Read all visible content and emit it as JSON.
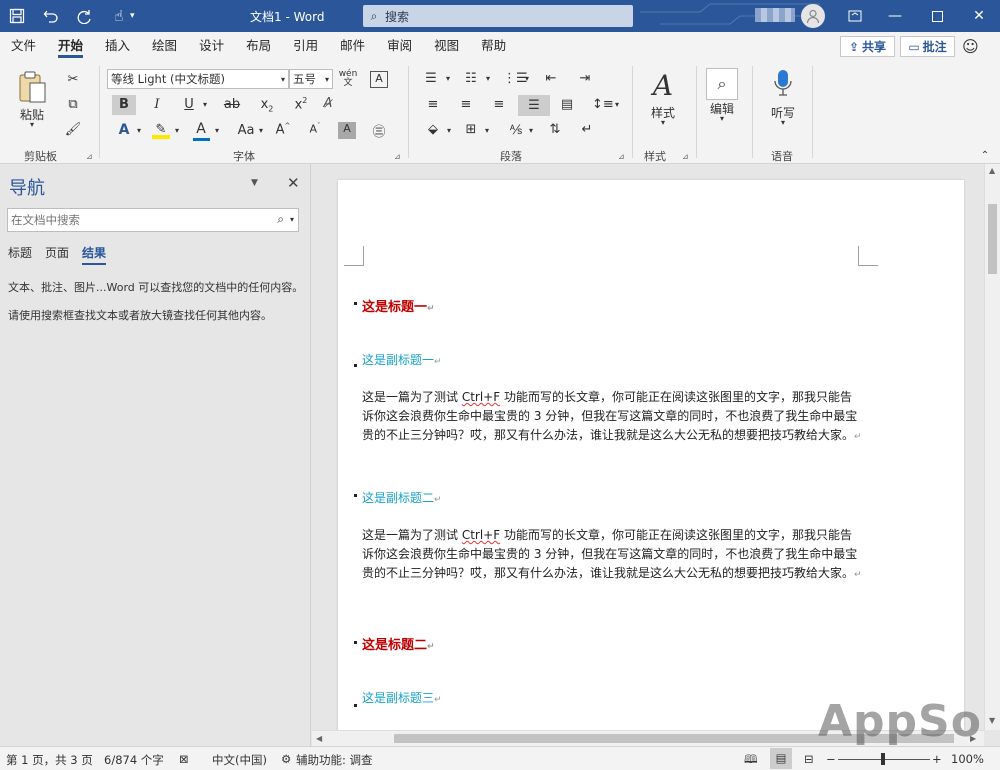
{
  "window": {
    "doc_title": "文档1  -  Word",
    "search_placeholder": "搜索"
  },
  "menu": {
    "tabs": [
      "文件",
      "开始",
      "插入",
      "绘图",
      "设计",
      "布局",
      "引用",
      "邮件",
      "审阅",
      "视图",
      "帮助"
    ],
    "active_tab": "开始",
    "share_label": "共享",
    "comment_label": "批注"
  },
  "ribbon": {
    "paste_label": "粘贴",
    "clipboard_group": "剪贴板",
    "font_name": "等线 Light (中文标题)",
    "font_size": "五号",
    "font_group": "字体",
    "font_color": "#0070c0",
    "highlight_color": "#ffe800",
    "paragraph_group": "段落",
    "styles_label": "样式",
    "styles_group": "样式",
    "editing_label": "编辑",
    "dictate_label": "听写",
    "voice_group": "语音"
  },
  "nav": {
    "title": "导航",
    "search_placeholder": "在文档中搜索",
    "tabs": [
      "标题",
      "页面",
      "结果"
    ],
    "active_tab": "结果",
    "msg1": "文本、批注、图片...Word 可以查找您的文档中的任何内容。",
    "msg2": "请使用搜索框查找文本或者放大镜查找任何其他内容。"
  },
  "document": {
    "heading1": "这是标题一",
    "subheading1": "这是副标题一",
    "para1_a": "这是一篇为了测试 ",
    "para1_key": "Ctrl+F",
    "para1_b": " 功能而写的长文章，你可能正在阅读这张图里的文字，那我只能告诉你这会浪费你生命中最宝贵的 3 分钟，但我在写这篇文章的同时，不也浪费了我生命中最宝贵的不止三分钟吗？哎，那又有什么办法，谁让我就是这么大公无私的想要把技巧教给大家。",
    "subheading2": "这是副标题二",
    "para2_a": "这是一篇为了测试 ",
    "para2_key": "Ctrl+F",
    "para2_b": " 功能而写的长文章，你可能正在阅读这张图里的文字，那我只能告诉你这会浪费你生命中最宝贵的 3 分钟，但我在写这篇文章的同时，不也浪费了我生命中最宝贵的不止三分钟吗？哎，那又有什么办法，谁让我就是这么大公无私的想要把技巧教给大家。",
    "heading2": "这是标题二",
    "subheading3": "这是副标题三",
    "para_mark": "↵"
  },
  "status": {
    "page": "第 1 页，共 3 页",
    "words": "6/874 个字",
    "language": "中文(中国)",
    "accessibility": "辅助功能: 调查",
    "zoom": "100%"
  },
  "watermark": "AppSo"
}
